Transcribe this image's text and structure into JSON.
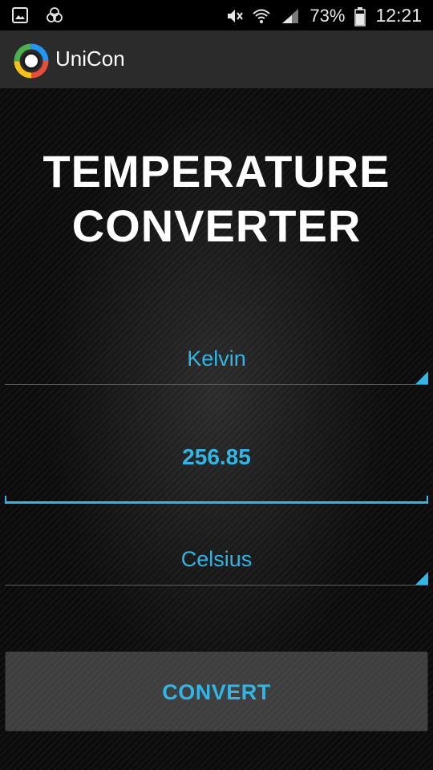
{
  "status_bar": {
    "battery": "73%",
    "time": "12:21",
    "icons": [
      "gallery-icon",
      "notification-icon",
      "mute-icon",
      "wifi-icon",
      "signal-icon",
      "battery-icon"
    ]
  },
  "app_bar": {
    "title": "UniCon",
    "logo_icon": "unicon-logo-icon"
  },
  "main": {
    "title_line1": "TEMPERATURE",
    "title_line2": "CONVERTER",
    "from_unit": "Kelvin",
    "input_value": "256.85",
    "to_unit": "Celsius",
    "convert_label": "CONVERT"
  },
  "colors": {
    "accent": "#33b5e5",
    "app_bar": "#2b2b2b",
    "background": "#0b0b0b",
    "button": "#3e3e3e"
  }
}
